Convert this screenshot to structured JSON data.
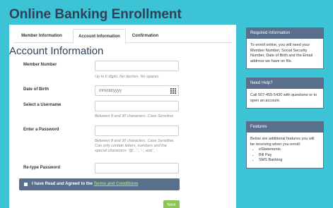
{
  "page": {
    "title": "Online Banking Enrollment"
  },
  "tabs": [
    {
      "label": "Member Information"
    },
    {
      "label": "Account Information"
    },
    {
      "label": "Confirmation"
    }
  ],
  "section": {
    "title": "Account Information"
  },
  "form": {
    "member_number": {
      "label": "Member Number",
      "help": "Up to 6 digits. No dashes. No spaces"
    },
    "dob": {
      "label": "Date of Birth",
      "placeholder": "mm/dd/yyyy"
    },
    "username": {
      "label": "Select a Username",
      "help": "Between 8 and 30 characters. Case Sensitive"
    },
    "password": {
      "label": "Enter a Password",
      "help": "Between 8 and 30 characters. Case Sensitive. Can only contain letters, numbers and the special characters: '@', '.', '-', and '_'."
    },
    "retype": {
      "label": "Re-type Password"
    }
  },
  "agree": {
    "prefix": "I have Read and Agreed to the",
    "link": "Terms and Conditions"
  },
  "next_label": "Next",
  "panels": {
    "required": {
      "title": "Required Information",
      "body": "To enroll online, you will need your Member Number, Social Security Number, Date of Birth and the Email address we have on file."
    },
    "help": {
      "title": "Need Help?",
      "body": "Call 507-455-5430 with questions or to open an account."
    },
    "features": {
      "title": "Features",
      "body": "Below are additional features you will be receiving when you enroll:",
      "items": [
        "eStatements",
        "Bill Pay",
        "SMS Banking"
      ]
    }
  }
}
